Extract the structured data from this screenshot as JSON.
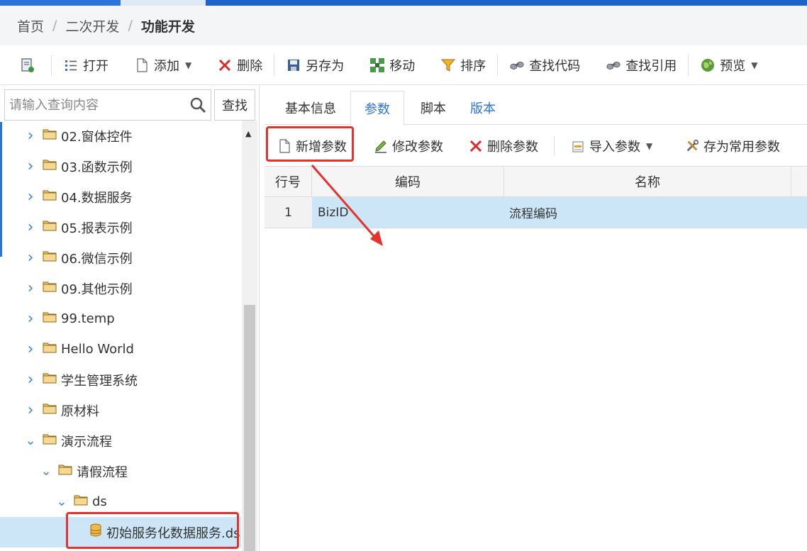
{
  "breadcrumb": {
    "home": "首页",
    "level2": "二次开发",
    "current": "功能开发",
    "separator": "/"
  },
  "toolbar": {
    "new_icon": "new-document-icon",
    "open": "打开",
    "add": "添加",
    "delete": "删除",
    "save_as": "另存为",
    "move": "移动",
    "sort": "排序",
    "find_code": "查找代码",
    "find_ref": "查找引用",
    "preview": "预览"
  },
  "search": {
    "placeholder": "请输入查询内容",
    "button": "查找"
  },
  "tree": {
    "items": [
      {
        "label": "02.窗体控件",
        "expanded": false,
        "level": 0
      },
      {
        "label": "03.函数示例",
        "expanded": false,
        "level": 0
      },
      {
        "label": "04.数据服务",
        "expanded": false,
        "level": 0
      },
      {
        "label": "05.报表示例",
        "expanded": false,
        "level": 0
      },
      {
        "label": "06.微信示例",
        "expanded": false,
        "level": 0
      },
      {
        "label": "09.其他示例",
        "expanded": false,
        "level": 0
      },
      {
        "label": "99.temp",
        "expanded": false,
        "level": 0
      },
      {
        "label": "Hello World",
        "expanded": false,
        "level": 0
      },
      {
        "label": "学生管理系统",
        "expanded": false,
        "level": 0
      },
      {
        "label": "原材料",
        "expanded": false,
        "level": 0
      },
      {
        "label": "演示流程",
        "expanded": true,
        "level": 0
      },
      {
        "label": "请假流程",
        "expanded": true,
        "level": 1
      },
      {
        "label": "ds",
        "expanded": true,
        "level": 2
      },
      {
        "label": "初始服务化数据服务.ds",
        "expanded": false,
        "level": 3,
        "selected": true
      }
    ]
  },
  "tabs": {
    "basic": "基本信息",
    "params": "参数",
    "script": "脚本",
    "version": "版本"
  },
  "param_toolbar": {
    "add": "新增参数",
    "edit": "修改参数",
    "delete": "删除参数",
    "import": "导入参数",
    "save_common": "存为常用参数"
  },
  "grid": {
    "columns": [
      "行号",
      "编码",
      "名称"
    ],
    "rows": [
      {
        "row_no": "1",
        "code": "BizID",
        "name": "流程编码"
      }
    ]
  },
  "colors": {
    "accent": "#2c74da",
    "highlight": "#e5322d",
    "selection": "#cde6f7"
  }
}
